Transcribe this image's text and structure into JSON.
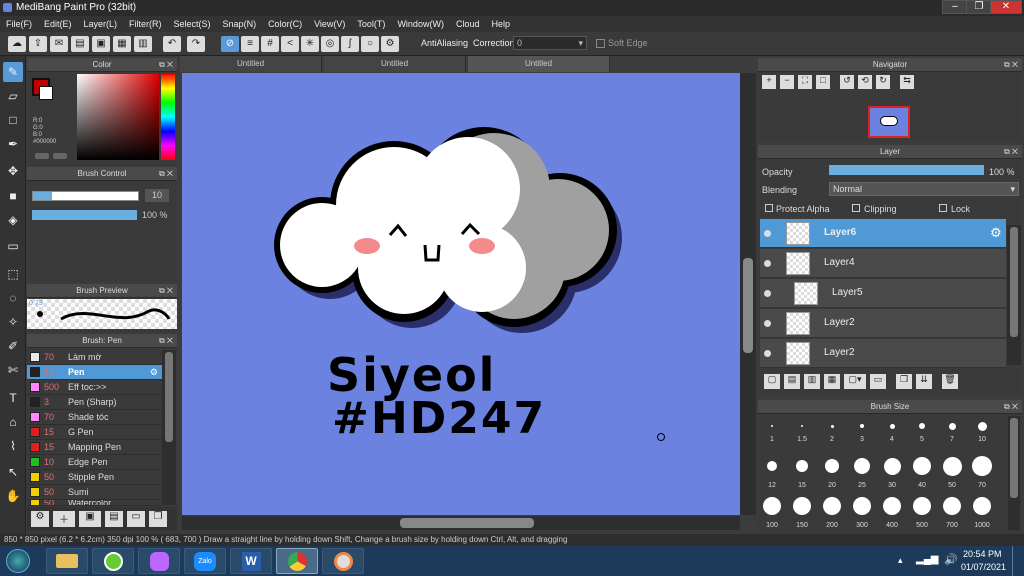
{
  "app": {
    "title": "MediBang Paint Pro (32bit)"
  },
  "menu": [
    "File(F)",
    "Edit(E)",
    "Layer(L)",
    "Filter(R)",
    "Select(S)",
    "Snap(N)",
    "Color(C)",
    "View(V)",
    "Tool(T)",
    "Window(W)",
    "Cloud",
    "Help"
  ],
  "toolbar": {
    "antialiasing_label": "AntiAliasing",
    "correction_label": "Correction",
    "correction_value": "0",
    "soft_edge_label": "Soft Edge"
  },
  "tabs": [
    "Untitled",
    "Untitled",
    "Untitled"
  ],
  "color_panel": {
    "title": "Color",
    "r": "R:0",
    "g": "G:0",
    "b": "B:0",
    "hex": "#000000",
    "primary": "#c00000",
    "secondary": "#ffffff"
  },
  "brush_control": {
    "title": "Brush Control",
    "size": "10",
    "opacity": "100 %"
  },
  "brush_preview": {
    "title": "Brush Preview",
    "size_label": "0.73"
  },
  "brush_list": {
    "title": "Brush: Pen",
    "items": [
      {
        "size": "70",
        "name": "Làm mờ",
        "color": "#e8e8e8"
      },
      {
        "size": "10",
        "name": "Pen",
        "color": "#222222",
        "selected": true
      },
      {
        "size": "500",
        "name": "Eff toc:>>",
        "color": "#ff88ff"
      },
      {
        "size": "3",
        "name": "Pen (Sharp)",
        "color": "#222222"
      },
      {
        "size": "70",
        "name": "Shade tóc",
        "color": "#ff88ff"
      },
      {
        "size": "15",
        "name": "G Pen",
        "color": "#e02020"
      },
      {
        "size": "15",
        "name": "Mapping Pen",
        "color": "#e02020"
      },
      {
        "size": "10",
        "name": "Edge Pen",
        "color": "#20c020"
      },
      {
        "size": "50",
        "name": "Stipple Pen",
        "color": "#f0d000"
      },
      {
        "size": "50",
        "name": "Sumi",
        "color": "#f0d000"
      },
      {
        "size": "50",
        "name": "Watercolor",
        "color": "#f0d000"
      }
    ]
  },
  "navigator": {
    "title": "Navigator"
  },
  "layer_panel": {
    "title": "Layer",
    "opacity_label": "Opacity",
    "opacity_value": "100 %",
    "blending_label": "Blending",
    "blending_value": "Normal",
    "protect_alpha": "Protect Alpha",
    "clipping": "Clipping",
    "lock": "Lock",
    "layers": [
      {
        "name": "Layer6",
        "selected": true
      },
      {
        "name": "Layer4"
      },
      {
        "name": "Layer5"
      },
      {
        "name": "Layer2"
      },
      {
        "name": "Layer2"
      }
    ]
  },
  "brush_size": {
    "title": "Brush Size",
    "sizes": [
      "1",
      "1.5",
      "2",
      "3",
      "4",
      "5",
      "7",
      "10",
      "12",
      "15",
      "20",
      "25",
      "30",
      "40",
      "50",
      "70",
      "100",
      "150",
      "200",
      "300",
      "400",
      "500",
      "700",
      "1000"
    ]
  },
  "canvas": {
    "bg": "#6b82e0",
    "text_line1": "Siyeol",
    "text_line2": "#HD247"
  },
  "status": {
    "text": "850 * 850 pixel   (6.2 * 6.2cm)   350 dpi   100 %   ( 683, 700 )   Draw a straight line by holding down Shift, Change a brush size by holding down Ctrl, Alt, and dragging"
  },
  "taskbar": {
    "time": "20:54 PM",
    "date": "01/07/2021",
    "zalo": "Zalo"
  }
}
